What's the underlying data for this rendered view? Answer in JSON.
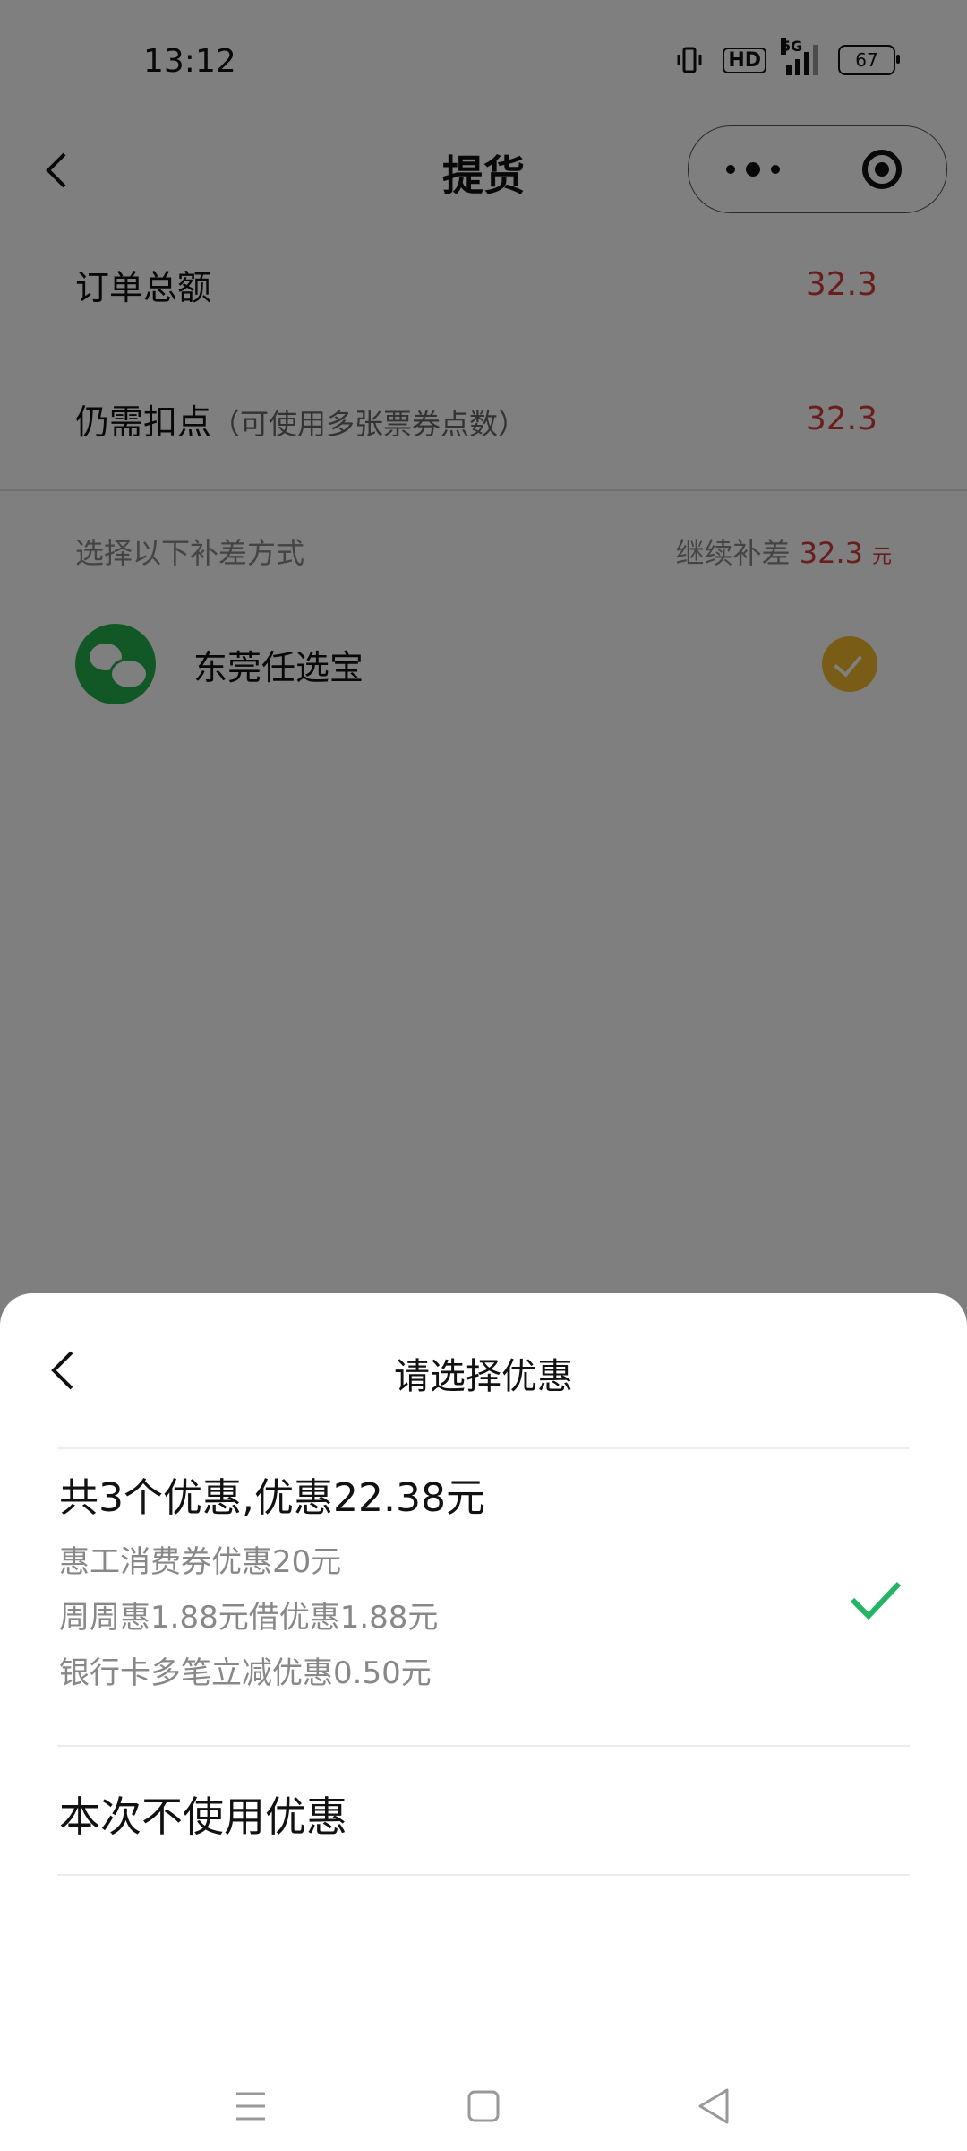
{
  "status_bar": {
    "time": "13:12",
    "network": "5G",
    "hd_label": "HD",
    "battery": "67"
  },
  "nav": {
    "title": "提货"
  },
  "order": {
    "total_label": "订单总额",
    "total_value": "32.3",
    "remaining_label": "仍需扣点",
    "remaining_hint": "（可使用多张票券点数）",
    "remaining_value": "32.3"
  },
  "payment": {
    "section_label": "选择以下补差方式",
    "continue_label": "继续补差",
    "continue_amount": "32.3",
    "continue_unit": "元",
    "method_name": "东莞任选宝"
  },
  "sheet": {
    "title": "请选择优惠",
    "coupon_summary": "共3个优惠,优惠22.38元",
    "coupon_details": [
      "惠工消费券优惠20元",
      "周周惠1.88元借优惠1.88元",
      "银行卡多笔立减优惠0.50元"
    ],
    "no_coupon_label": "本次不使用优惠"
  },
  "colors": {
    "accent_red": "#d43a3a",
    "wechat_green": "#22b14c",
    "check_green": "#22b565",
    "check_gold": "#f3b92a"
  }
}
